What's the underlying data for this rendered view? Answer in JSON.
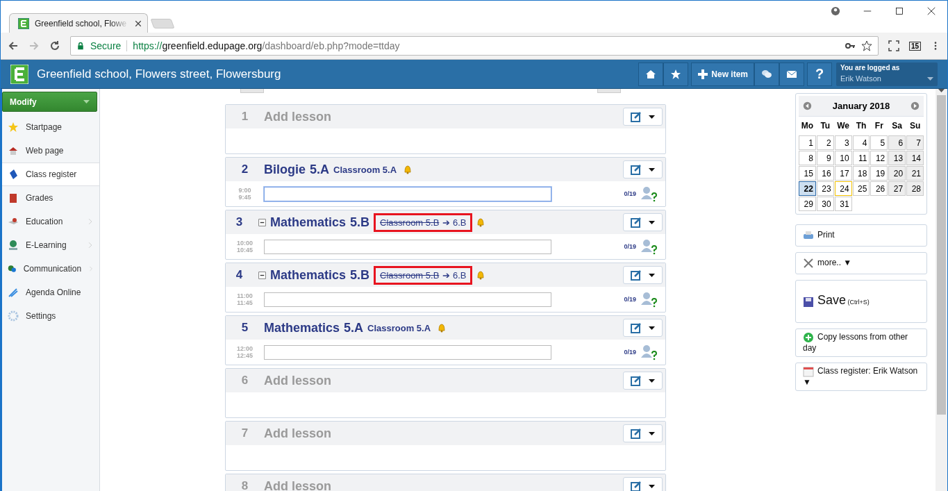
{
  "browser": {
    "tab_title": "Greenfield school, Flowe",
    "secure_label": "Secure",
    "url_scheme": "https://",
    "url_host": "greenfield.edupage.org",
    "url_path": "/dashboard/eb.php?mode=ttday",
    "extension_badge": "15"
  },
  "header": {
    "school_name": "Greenfield school, Flowers street, Flowersburg",
    "new_item": "New item",
    "help": "?",
    "login_caption": "You are logged as",
    "user_name": "Erik Watson"
  },
  "sidebar": {
    "modify": "Modify",
    "items": [
      {
        "label": "Startpage",
        "selected": false,
        "has_submenu": false
      },
      {
        "label": "Web page",
        "selected": false,
        "has_submenu": false
      },
      {
        "label": "Class register",
        "selected": true,
        "has_submenu": false
      },
      {
        "label": "Grades",
        "selected": false,
        "has_submenu": false
      },
      {
        "label": "Education",
        "selected": false,
        "has_submenu": true
      },
      {
        "label": "E-Learning",
        "selected": false,
        "has_submenu": true
      },
      {
        "label": "Communication",
        "selected": false,
        "has_submenu": true
      },
      {
        "label": "Agenda Online",
        "selected": false,
        "has_submenu": false
      },
      {
        "label": "Settings",
        "selected": false,
        "has_submenu": false
      }
    ]
  },
  "lessons": [
    {
      "kind": "empty",
      "number": "1",
      "title": "Add lesson"
    },
    {
      "kind": "lesson",
      "number": "2",
      "subject": "Bilogie",
      "class": "5.A",
      "room": "Classroom 5.A",
      "collapsible": false,
      "start": "9:00",
      "end": "9:45",
      "attendance": "0/19",
      "focused": true
    },
    {
      "kind": "lesson",
      "number": "3",
      "subject": "Mathematics",
      "class": "5.B",
      "room_change": {
        "old": "Classroom 5.B",
        "new": "➔ 6.B",
        "highlighted": true
      },
      "collapsible": true,
      "start": "10:00",
      "end": "10:45",
      "attendance": "0/19",
      "focused": false
    },
    {
      "kind": "lesson",
      "number": "4",
      "subject": "Mathematics",
      "class": "5.B",
      "room_change": {
        "old": "Classroom 5.B",
        "new": "➔ 6.B",
        "highlighted": true
      },
      "collapsible": true,
      "start": "11:00",
      "end": "11:45",
      "attendance": "0/19",
      "focused": false
    },
    {
      "kind": "lesson",
      "number": "5",
      "subject": "Mathematics",
      "class": "5.A",
      "room": "Classroom 5.A",
      "collapsible": false,
      "start": "12:00",
      "end": "12:45",
      "attendance": "0/19",
      "focused": false
    },
    {
      "kind": "empty",
      "number": "6",
      "title": "Add lesson"
    },
    {
      "kind": "empty",
      "number": "7",
      "title": "Add lesson"
    },
    {
      "kind": "empty",
      "number": "8",
      "title": "Add lesson"
    }
  ],
  "calendar": {
    "title": "January 2018",
    "weekdays": [
      "Mo",
      "Tu",
      "We",
      "Th",
      "Fr",
      "Sa",
      "Su"
    ],
    "days": [
      {
        "label": "1",
        "weekend": false,
        "selected": false,
        "today": false
      },
      {
        "label": "2",
        "weekend": false,
        "selected": false,
        "today": false
      },
      {
        "label": "3",
        "weekend": false,
        "selected": false,
        "today": false
      },
      {
        "label": "4",
        "weekend": false,
        "selected": false,
        "today": false
      },
      {
        "label": "5",
        "weekend": false,
        "selected": false,
        "today": false
      },
      {
        "label": "6",
        "weekend": true,
        "selected": false,
        "today": false
      },
      {
        "label": "7",
        "weekend": true,
        "selected": false,
        "today": false
      },
      {
        "label": "8",
        "weekend": false,
        "selected": false,
        "today": false
      },
      {
        "label": "9",
        "weekend": false,
        "selected": false,
        "today": false
      },
      {
        "label": "10",
        "weekend": false,
        "selected": false,
        "today": false
      },
      {
        "label": "11",
        "weekend": false,
        "selected": false,
        "today": false
      },
      {
        "label": "12",
        "weekend": false,
        "selected": false,
        "today": false
      },
      {
        "label": "13",
        "weekend": true,
        "selected": false,
        "today": false
      },
      {
        "label": "14",
        "weekend": true,
        "selected": false,
        "today": false
      },
      {
        "label": "15",
        "weekend": false,
        "selected": false,
        "today": false
      },
      {
        "label": "16",
        "weekend": false,
        "selected": false,
        "today": false
      },
      {
        "label": "17",
        "weekend": false,
        "selected": false,
        "today": false
      },
      {
        "label": "18",
        "weekend": false,
        "selected": false,
        "today": false
      },
      {
        "label": "19",
        "weekend": false,
        "selected": false,
        "today": false
      },
      {
        "label": "20",
        "weekend": true,
        "selected": false,
        "today": false
      },
      {
        "label": "21",
        "weekend": true,
        "selected": false,
        "today": false
      },
      {
        "label": "22",
        "weekend": false,
        "selected": true,
        "today": false
      },
      {
        "label": "23",
        "weekend": false,
        "selected": false,
        "today": false
      },
      {
        "label": "24",
        "weekend": false,
        "selected": false,
        "today": true
      },
      {
        "label": "25",
        "weekend": false,
        "selected": false,
        "today": false
      },
      {
        "label": "26",
        "weekend": false,
        "selected": false,
        "today": false
      },
      {
        "label": "27",
        "weekend": true,
        "selected": false,
        "today": false
      },
      {
        "label": "28",
        "weekend": true,
        "selected": false,
        "today": false
      },
      {
        "label": "29",
        "weekend": false,
        "selected": false,
        "today": false
      },
      {
        "label": "30",
        "weekend": false,
        "selected": false,
        "today": false
      },
      {
        "label": "31",
        "weekend": false,
        "selected": false,
        "today": false
      }
    ]
  },
  "actions": [
    {
      "kind": "print",
      "label": "Print"
    },
    {
      "kind": "more",
      "label": "more.. ▼"
    },
    {
      "kind": "save",
      "label": "Save",
      "hint": "(Ctrl+S)"
    },
    {
      "kind": "copy",
      "label": "Copy lessons from other day"
    },
    {
      "kind": "register",
      "label": "Class register: Erik Watson ▼"
    }
  ]
}
